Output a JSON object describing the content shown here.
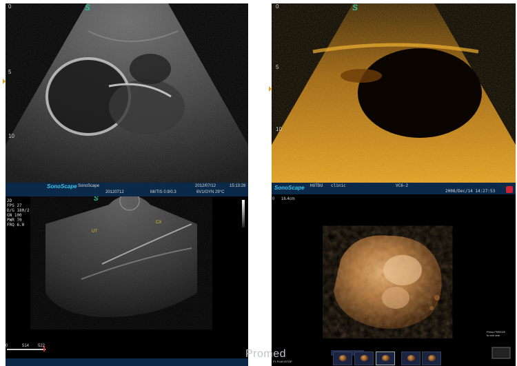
{
  "panel_tl": {
    "logo": "S",
    "depth_marks": [
      "0",
      "5",
      "10"
    ],
    "brand": "SonoScape",
    "brand_text": "SonoScape",
    "date_left": "20120712",
    "date_right": "2012/07/12",
    "mi_tis": "MI/TIS 0.9/0.3",
    "preset": "6V1/GYN 29°C",
    "time": "15:13:28"
  },
  "panel_tr": {
    "logo": "S",
    "depth_marks": [
      "0",
      "5",
      "10"
    ],
    "brand": "SonoScape",
    "hospital": "HUTDU",
    "clinic": "clinic",
    "probe": "VC6-2",
    "datetime": "2008/Dec/14 14:27:53"
  },
  "panel_bl": {
    "logo": "S",
    "params": [
      "2D",
      "FPS  27",
      "D/G  180/2",
      "GN  100",
      "PWR 70",
      "FRQ  6.0"
    ],
    "label_ut": "UT",
    "label_cx": "CX",
    "scale_labels": [
      "0",
      "514",
      "522"
    ]
  },
  "panel_br": {
    "depth_top": "0",
    "depth_value": "16.4cm",
    "freeze_hint_line1": "Press FREEZE",
    "freeze_hint_line2": "to exit cine",
    "footer_hint": "F1 PLAY/STOP"
  },
  "watermark": "Promed"
}
